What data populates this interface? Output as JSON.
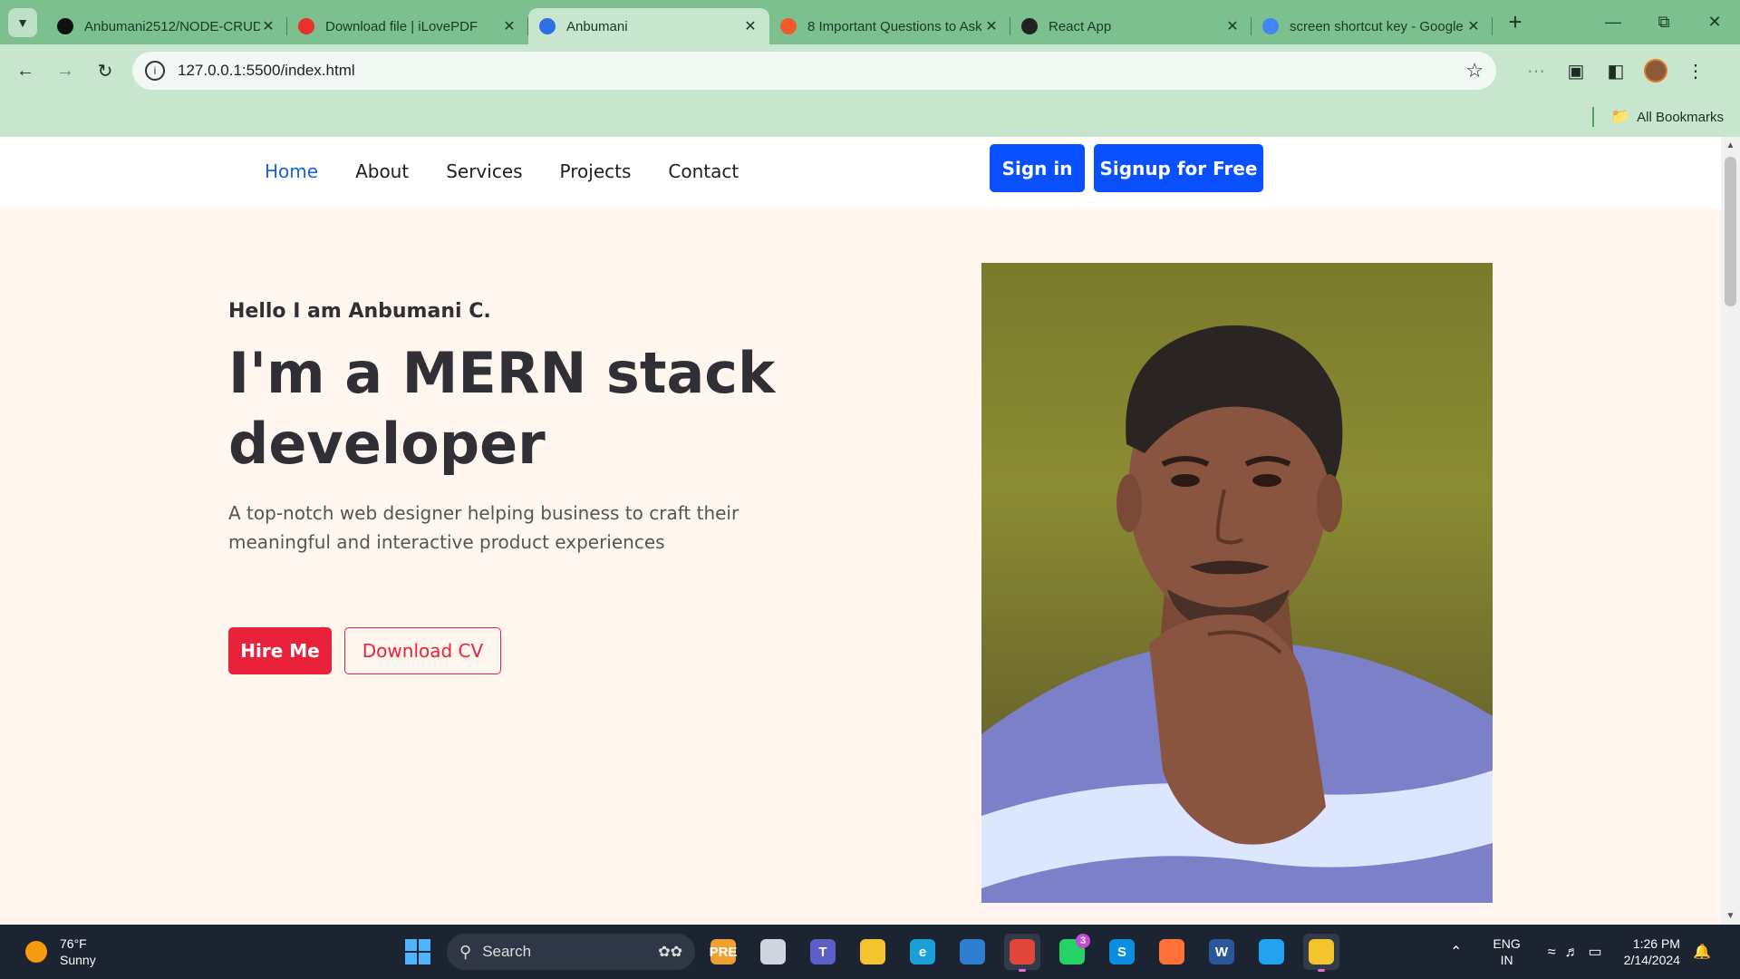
{
  "browser": {
    "tab_search_icon": "chevron-down",
    "tabs": [
      {
        "title": "Anbumani2512/NODE-CRUD",
        "favicon": "github-icon",
        "color": "#111111"
      },
      {
        "title": "Download file | iLovePDF",
        "favicon": "heart-icon",
        "color": "#e5322d"
      },
      {
        "title": "Anbumani",
        "favicon": "w-icon",
        "color": "#2f6fe4",
        "active": true
      },
      {
        "title": "8 Important Questions to Ask",
        "favicon": "bars-icon",
        "color": "#f05a28"
      },
      {
        "title": "React App",
        "favicon": "react-icon",
        "color": "#222222"
      },
      {
        "title": "screen shortcut key - Google Search",
        "favicon": "google-icon",
        "color": "#4285f4"
      }
    ],
    "new_tab": "+",
    "address": "127.0.0.1:5500/index.html",
    "bookmarks_label": "All Bookmarks"
  },
  "site": {
    "nav": {
      "links": [
        "Home",
        "About",
        "Services",
        "Projects",
        "Contact"
      ],
      "active": "Home",
      "sign_in": "Sign in",
      "sign_up": "Signup for Free"
    },
    "hero": {
      "greeting": "Hello I am Anbumani C.",
      "title": "I'm a MERN stack developer",
      "description": "A top-notch web designer helping business to craft their meaningful and interactive product experiences",
      "hire_button": "Hire Me",
      "cv_button": "Download CV"
    },
    "colors": {
      "primary_blue": "#0a50ff",
      "accent_red": "#e8223a",
      "hero_bg": "#fff6f0"
    }
  },
  "taskbar": {
    "weather_temp": "76°F",
    "weather_desc": "Sunny",
    "search_placeholder": "Search",
    "apps": [
      {
        "name": "copilot",
        "label": "PRE"
      },
      {
        "name": "task-view",
        "label": ""
      },
      {
        "name": "teams",
        "label": "T"
      },
      {
        "name": "file-explorer",
        "label": ""
      },
      {
        "name": "edge",
        "label": "e"
      },
      {
        "name": "microsoft-store",
        "label": ""
      },
      {
        "name": "chrome",
        "label": "",
        "active": true
      },
      {
        "name": "whatsapp",
        "label": "",
        "badge": "3"
      },
      {
        "name": "skype",
        "label": "S"
      },
      {
        "name": "firefox",
        "label": ""
      },
      {
        "name": "word",
        "label": "W"
      },
      {
        "name": "vscode",
        "label": ""
      },
      {
        "name": "notes",
        "label": "",
        "active": true
      }
    ],
    "lang_top": "ENG",
    "lang_bottom": "IN",
    "time": "1:26 PM",
    "date": "2/14/2024"
  }
}
